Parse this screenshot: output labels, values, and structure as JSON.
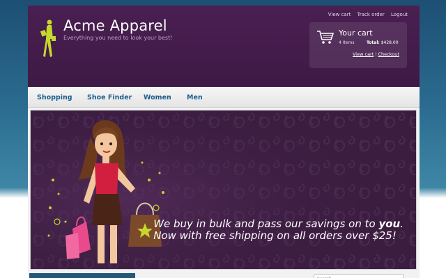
{
  "site": {
    "title": "Acme Apparel",
    "tagline": "Everything you need to look your best!"
  },
  "top_links": [
    "View cart",
    "Track order",
    "Logout"
  ],
  "cart": {
    "title": "Your cart",
    "items": "4 Items",
    "total_label": "Total:",
    "total_value": "$428.00",
    "view_cart": "View cart",
    "separator": "|",
    "checkout": "Checkout"
  },
  "nav": [
    "Shopping",
    "Shoe Finder",
    "Women",
    "Men"
  ],
  "banner": {
    "line1_pre": "We buy in bulk and pass our savings on to ",
    "line1_bold": "you",
    "line1_post": ".",
    "line2": "Now with free shipping on all orders over $25!"
  },
  "search": {
    "placeholder": "Search"
  },
  "colors": {
    "header": "#4a1f52",
    "nav_text": "#1f5f8b",
    "banner_bg": "#3b1d40",
    "logo_accent": "#c6d82b",
    "shopping_bag_pink": "#e94a8b"
  }
}
